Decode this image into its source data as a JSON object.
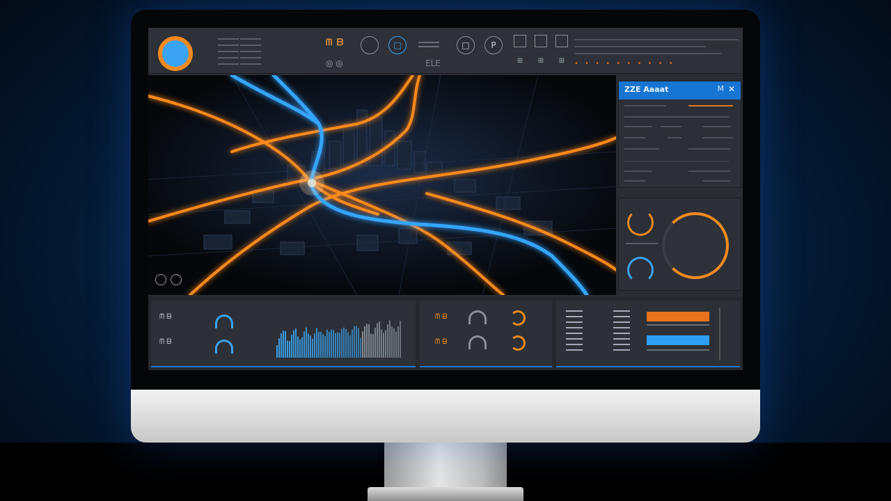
{
  "topbar": {
    "code_left": "ᗰ ᗷ",
    "code_left2": "◎ ◎",
    "buttons": [
      "□",
      "□",
      "P"
    ],
    "status_text": "ELE",
    "ticker_dots": "• • • • • • • • • •"
  },
  "side_panel": {
    "title": "ZZE Aaaat",
    "close": "✕",
    "pin": "M"
  },
  "colors": {
    "accent_orange": "#f08a1f",
    "accent_blue": "#3aa3f2",
    "panel_bg": "#2c2f35",
    "header_blue": "#1675d2"
  },
  "bottom": {
    "label_a": "ᗰ ᗷ",
    "label_b": "ᗰ ᗷ",
    "label_c": "ᗰ ᗷ",
    "label_d": "ᗰ ᗷ"
  },
  "icons": [
    "logo-ring-icon",
    "map-layer-icon",
    "close-icon",
    "gauge-icon"
  ]
}
